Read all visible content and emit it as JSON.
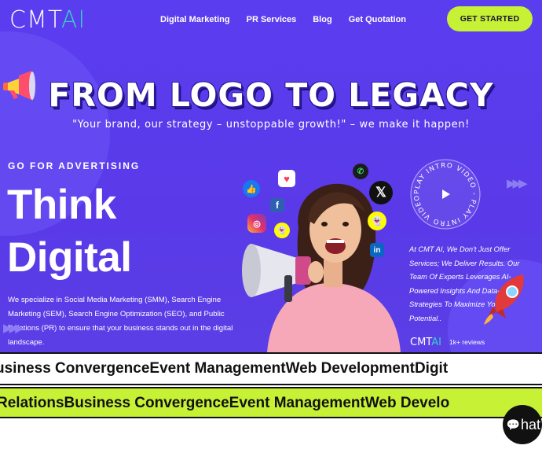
{
  "brand": {
    "logo_main": "CMT",
    "logo_ai": "AI"
  },
  "nav": {
    "items": [
      {
        "label": "Digital Marketing"
      },
      {
        "label": "PR Services"
      },
      {
        "label": "Blog"
      },
      {
        "label": "Get Quotation"
      }
    ],
    "cta_label": "GET STARTED"
  },
  "hero": {
    "headline": "FROM LOGO TO LEGACY",
    "tagline": "\"Your brand, our strategy – unstoppable growth!\" – we make it happen!",
    "eyebrow": "GO FOR ADVERTISING",
    "big_line_1": "Think",
    "big_line_2": "Digital",
    "description": "We specialize in Social Media Marketing (SMM), Search Engine Marketing (SEM), Search Engine Optimization (SEO), and Public Relations (PR) to ensure that your business stands out in the digital landscape.",
    "play_ring_text": "PLAY INTRO VIDEO - PLAY INTRO VIDEO - ",
    "right_copy": "At CMT AI, We Don't Just Offer Services; We Deliver Results. Our Team Of Experts Leverages AI-Powered Insights And Data-Driven Strategies To Maximize Your Potential..",
    "mini_logo_main": "CMT",
    "mini_logo_ai": "AI",
    "reviews": "1k+ reviews"
  },
  "marquee_top": {
    "items": [
      "usiness Convergence",
      "Event Management",
      "Web Development",
      "Digit"
    ]
  },
  "marquee_bottom": {
    "items": [
      "Relations",
      "Business Convergence",
      "Event Management",
      "Web Develo"
    ]
  },
  "chat": {
    "label": "hat"
  },
  "colors": {
    "hero_bg": "#5b3df0",
    "accent_lime": "#c6f135",
    "logo_teal": "#34d3c3"
  },
  "icons": [
    "megaphone-icon",
    "facebook-icon",
    "instagram-icon",
    "snapchat-icon",
    "x-icon",
    "linkedin-icon",
    "whatsapp-icon",
    "heart-icon",
    "thumbs-up-icon",
    "play-icon",
    "rocket-icon",
    "sparkle-star-icon",
    "chat-icon"
  ]
}
